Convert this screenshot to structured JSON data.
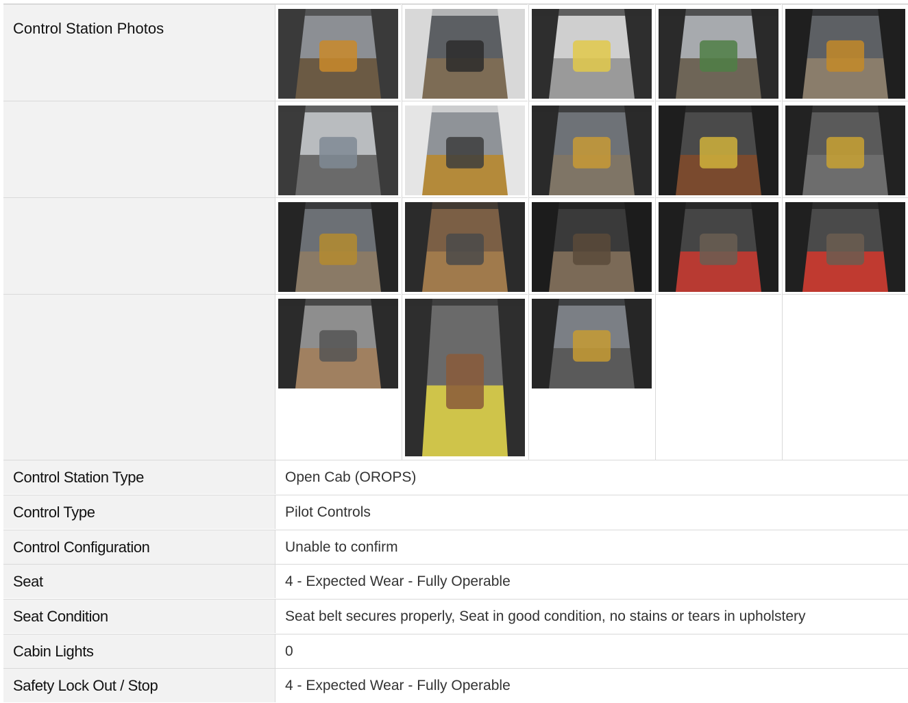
{
  "photos": {
    "section_label": "Control Station Photos",
    "thumbnails": [
      {
        "alt": "cab-view-excavator"
      },
      {
        "alt": "gauge-panel"
      },
      {
        "alt": "switch-panel"
      },
      {
        "alt": "overhead-panel"
      },
      {
        "alt": "cab-roof-view"
      },
      {
        "alt": "roof-grille"
      },
      {
        "alt": "rear-window"
      },
      {
        "alt": "front-window"
      },
      {
        "alt": "right-joystick"
      },
      {
        "alt": "seat-and-joystick"
      },
      {
        "alt": "left-console"
      },
      {
        "alt": "joystick-closeup"
      },
      {
        "alt": "armrest"
      },
      {
        "alt": "seat-interior"
      },
      {
        "alt": "seat-side"
      },
      {
        "alt": "seat-front"
      },
      {
        "alt": "floor-mat"
      },
      {
        "alt": "cab-front-view"
      }
    ]
  },
  "specs": [
    {
      "label": "Control Station Type",
      "value": "Open Cab (OROPS)"
    },
    {
      "label": "Control Type",
      "value": "Pilot Controls"
    },
    {
      "label": "Control Configuration",
      "value": "Unable to confirm"
    },
    {
      "label": "Seat",
      "value": "4 - Expected Wear - Fully Operable"
    },
    {
      "label": "Seat Condition",
      "value": "Seat belt secures properly, Seat in good condition, no stains or tears in upholstery"
    },
    {
      "label": "Cabin Lights",
      "value": "0"
    },
    {
      "label": "Safety Lock Out / Stop",
      "value": "4 - Expected Wear - Fully Operable"
    }
  ]
}
